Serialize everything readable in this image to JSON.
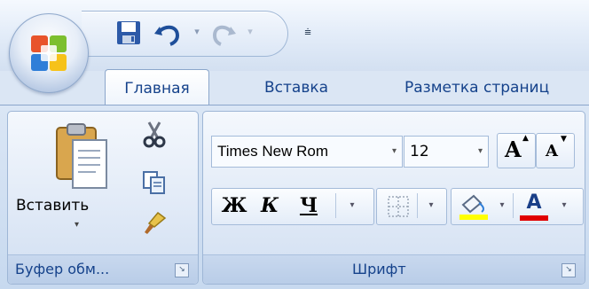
{
  "tabs": [
    {
      "label": "Главная",
      "active": true
    },
    {
      "label": "Вставка",
      "active": false
    },
    {
      "label": "Разметка страниц",
      "active": false
    }
  ],
  "quick_access": {
    "icons": [
      "save-icon",
      "undo-icon",
      "redo-icon",
      "customize-icon"
    ]
  },
  "clipboard": {
    "paste_label": "Вставить",
    "group_label": "Буфер обм...",
    "icons": [
      "paste-icon",
      "cut-icon",
      "copy-icon",
      "format-painter-icon"
    ]
  },
  "font": {
    "group_label": "Шрифт",
    "font_name": "Times New Rom",
    "font_size": "12",
    "bold_label": "Ж",
    "italic_label": "К",
    "underline_label": "Ч",
    "grow_label": "A",
    "shrink_label": "A",
    "font_color_label": "A",
    "highlight_color": "#ffff00",
    "font_color": "#e00000"
  },
  "colors": {
    "tab_text": "#15428b",
    "ribbon_border": "#8ba6cb"
  }
}
